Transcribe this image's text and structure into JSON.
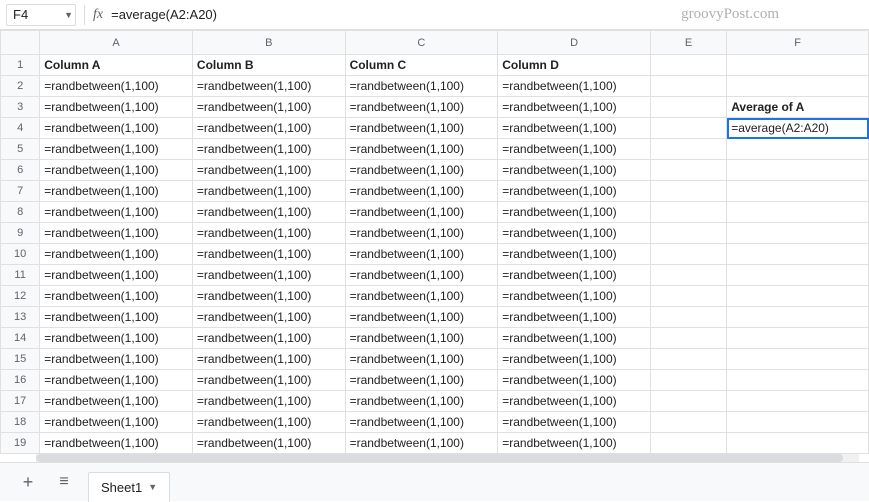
{
  "formula_bar": {
    "cell_ref": "F4",
    "formula": "=average(A2:A20)"
  },
  "watermark": "groovyPost.com",
  "columns": [
    "A",
    "B",
    "C",
    "D",
    "E",
    "F"
  ],
  "rows": [
    "1",
    "2",
    "3",
    "4",
    "5",
    "6",
    "7",
    "8",
    "9",
    "10",
    "11",
    "12",
    "13",
    "14",
    "15",
    "16",
    "17",
    "18",
    "19"
  ],
  "headers_row": {
    "A": "Column A",
    "B": "Column B",
    "C": "Column C",
    "D": "Column D"
  },
  "rb_formula": "=randbetween(1,100)",
  "f3_label": "Average of A",
  "f4_formula": "=average(A2:A20)",
  "selected_cell": "F4",
  "sheet_tab": "Sheet1"
}
